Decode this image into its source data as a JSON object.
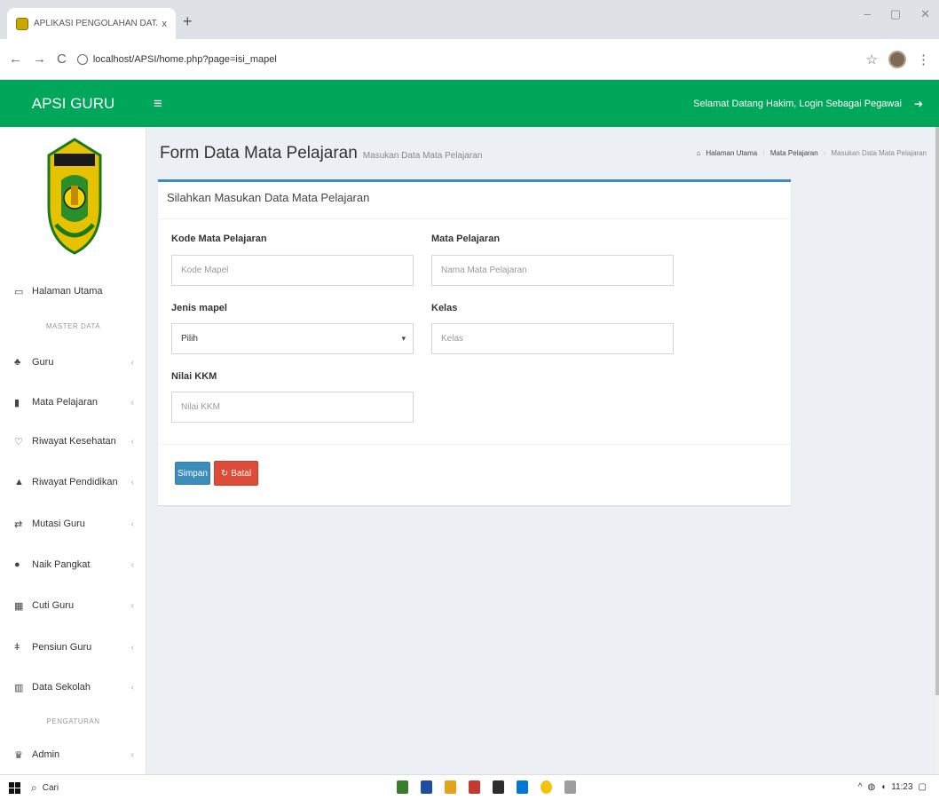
{
  "browser": {
    "tab_title": "APLIKASI PENGOLAHAN DATA G",
    "tab_close": "x",
    "new_tab": "+",
    "back": "←",
    "forward": "→",
    "reload": "C",
    "url": "localhost/APSI/home.php?page=isi_mapel",
    "star": "☆",
    "menu": "⋮",
    "win_min": "–",
    "win_max": "▢",
    "win_close": "✕"
  },
  "header": {
    "logo": "APSI GURU",
    "menu_toggle": "≡",
    "welcome": "Selamat Datang Hakim, Login Sebagai Pegawai",
    "signout": "➜"
  },
  "sidebar": {
    "home": "Halaman Utama",
    "master_header": "MASTER DATA",
    "items": [
      {
        "label": "Guru",
        "icon": "users-icon"
      },
      {
        "label": "Mata Pelajaran",
        "icon": "book-icon"
      },
      {
        "label": "Riwayat Kesehatan",
        "icon": "health-icon"
      },
      {
        "label": "Riwayat Pendidikan",
        "icon": "graduation-icon"
      },
      {
        "label": "Mutasi Guru",
        "icon": "exchange-icon"
      },
      {
        "label": "Naik Pangkat",
        "icon": "dot-icon"
      },
      {
        "label": "Cuti Guru",
        "icon": "calendar-icon"
      },
      {
        "label": "Pensiun Guru",
        "icon": "retire-icon"
      },
      {
        "label": "Data Sekolah",
        "icon": "building-icon"
      }
    ],
    "settings_header": "PENGATURAN",
    "admin": "Admin"
  },
  "page": {
    "title": "Form Data Mata Pelajaran",
    "subtitle": "Masukan Data Mata Pelajaran",
    "breadcrumb": [
      "Halaman Utama",
      "Mata Pelajaran",
      "Masukan Data Mata Pelajaran"
    ]
  },
  "form": {
    "box_title": "Silahkan Masukan Data Mata Pelajaran",
    "kode_label": "Kode Mata Pelajaran",
    "kode_placeholder": "Kode Mapel",
    "mapel_label": "Mata Pelajaran",
    "mapel_placeholder": "Nama Mata Pelajaran",
    "jenis_label": "Jenis mapel",
    "jenis_value": "Pilih",
    "kelas_label": "Kelas",
    "kelas_placeholder": "Kelas",
    "kkm_label": "Nilai KKM",
    "kkm_placeholder": "Nilai KKM",
    "save_label": "Simpan",
    "reset_label": "Batal"
  },
  "taskbar": {
    "search_text": "Cari",
    "time": "11:23"
  },
  "colors": {
    "brand": "#00a65a",
    "primary": "#3c8dbc",
    "danger": "#dd4b39"
  }
}
